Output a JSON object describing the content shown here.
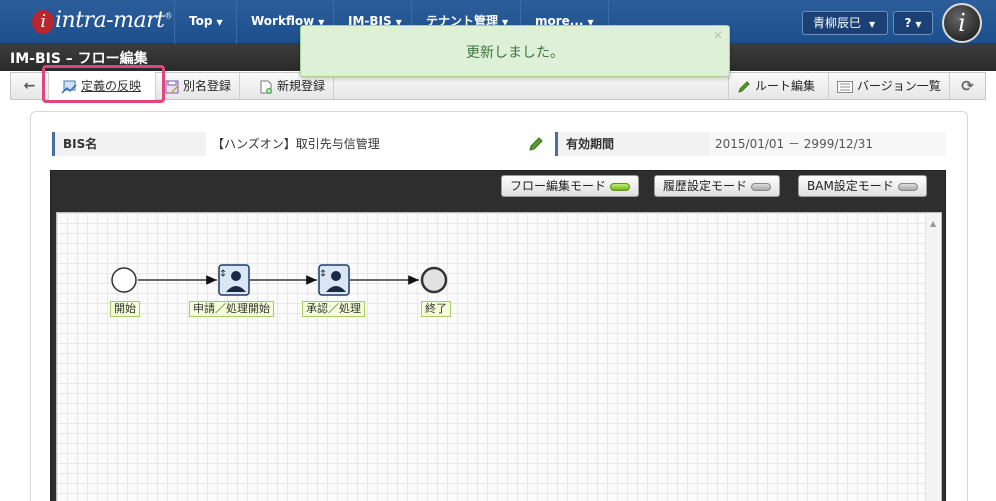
{
  "nav": {
    "brand": "intra-mart",
    "brand_mark": "®",
    "items": [
      {
        "label": "Top"
      },
      {
        "label": "Workflow"
      },
      {
        "label": "IM-BIS"
      },
      {
        "label": "テナント管理"
      },
      {
        "label": "more..."
      }
    ],
    "user": "青柳辰巳",
    "help": "?"
  },
  "title": "IM-BIS – フロー編集",
  "toast": {
    "message": "更新しました。",
    "close": "×"
  },
  "toolbar": {
    "back": "←",
    "reflect_definition": "定義の反映",
    "save_as": "別名登録",
    "new_register": "新規登録",
    "route_edit": "ルート編集",
    "version_list": "バージョン一覧",
    "refresh": "⟳"
  },
  "info": {
    "bis_name_label": "BIS名",
    "bis_name_value": "【ハンズオン】取引先与信管理",
    "validity_label": "有効期間",
    "validity_value": "2015/01/01 － 2999/12/31"
  },
  "modes": {
    "flow_edit": "フロー編集モード",
    "history": "履歴設定モード",
    "bam": "BAM設定モード"
  },
  "flow": {
    "nodes": [
      {
        "label": "開始"
      },
      {
        "label": "申請／処理開始"
      },
      {
        "label": "承認／処理"
      },
      {
        "label": "終了"
      }
    ]
  },
  "colors": {
    "nav_bg": "#1d4f8c",
    "highlight": "#e0457e",
    "toast_bg": "#dff0d8",
    "led_on": "#6fb51e"
  }
}
